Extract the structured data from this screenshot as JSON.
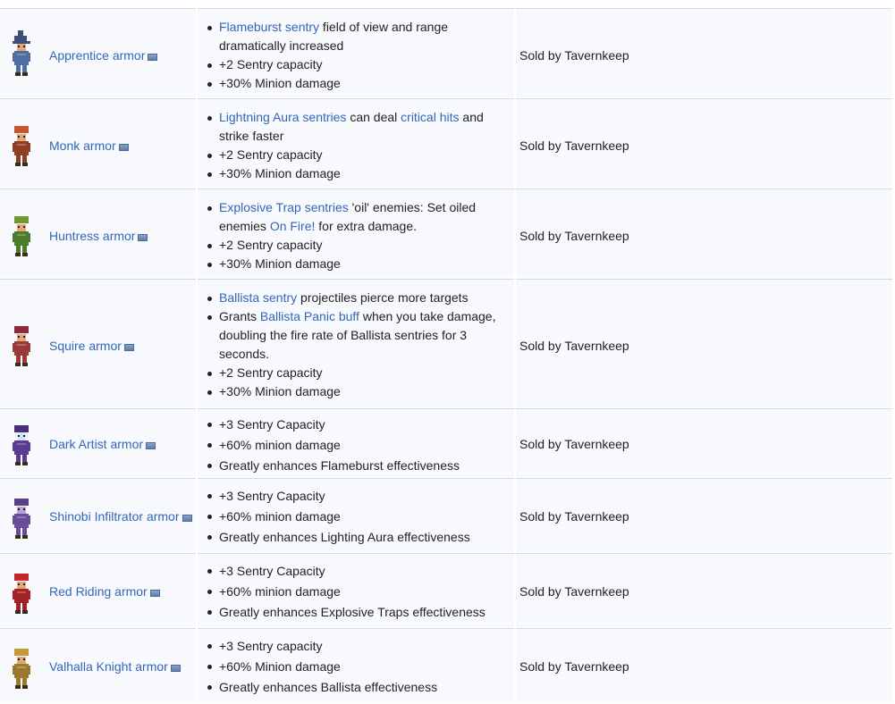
{
  "rows": [
    {
      "name": "Apprentice armor",
      "colors": {
        "hat": "#3d4f7a",
        "robe": "#4c6ea0",
        "skin": "#e3a77a"
      },
      "bullets": [
        {
          "parts": [
            {
              "t": "Flameburst sentry",
              "link": true
            },
            {
              "t": " field of view and range dramatically increased"
            }
          ]
        },
        {
          "parts": [
            {
              "t": "+2 Sentry capacity"
            }
          ]
        },
        {
          "parts": [
            {
              "t": "+30% Minion damage"
            }
          ]
        }
      ],
      "source": "Sold by Tavernkeep"
    },
    {
      "name": "Monk armor",
      "colors": {
        "hat": "#c5562b",
        "robe": "#8e3e24",
        "skin": "#e3a77a"
      },
      "bullets": [
        {
          "parts": [
            {
              "t": "Lightning Aura sentries",
              "link": true
            },
            {
              "t": " can deal "
            },
            {
              "t": "critical hits",
              "link": true
            },
            {
              "t": " and strike faster"
            }
          ]
        },
        {
          "parts": [
            {
              "t": "+2 Sentry capacity"
            }
          ]
        },
        {
          "parts": [
            {
              "t": "+30% Minion damage"
            }
          ]
        }
      ],
      "source": "Sold by Tavernkeep"
    },
    {
      "name": "Huntress armor",
      "colors": {
        "hat": "#6e9a2f",
        "robe": "#4d7a28",
        "skin": "#e3a77a"
      },
      "bullets": [
        {
          "parts": [
            {
              "t": "Explosive Trap sentries",
              "link": true
            },
            {
              "t": " 'oil' enemies: Set oiled enemies "
            },
            {
              "t": "On Fire!",
              "link": true
            },
            {
              "t": " for extra damage."
            }
          ]
        },
        {
          "parts": [
            {
              "t": "+2 Sentry capacity"
            }
          ]
        },
        {
          "parts": [
            {
              "t": "+30% Minion damage"
            }
          ]
        }
      ],
      "source": "Sold by Tavernkeep"
    },
    {
      "name": "Squire armor",
      "colors": {
        "hat": "#8c2b3a",
        "robe": "#9b3a3a",
        "skin": "#e3a77a"
      },
      "bullets": [
        {
          "parts": [
            {
              "t": "Ballista sentry",
              "link": true
            },
            {
              "t": " projectiles pierce more targets"
            }
          ]
        },
        {
          "parts": [
            {
              "t": "Grants "
            },
            {
              "t": "Ballista Panic buff",
              "link": true
            },
            {
              "t": " when you take damage, doubling the fire rate of Ballista sentries for 3 seconds."
            }
          ]
        },
        {
          "parts": [
            {
              "t": "+2 Sentry capacity"
            }
          ]
        },
        {
          "parts": [
            {
              "t": "+30% Minion damage"
            }
          ]
        }
      ],
      "source": "Sold by Tavernkeep"
    },
    {
      "name": "Dark Artist armor",
      "colors": {
        "hat": "#4a2f7a",
        "robe": "#5b3b8f",
        "skin": "#cfe8ff"
      },
      "bullets": [
        {
          "parts": [
            {
              "t": "+3 Sentry Capacity"
            }
          ]
        },
        {
          "parts": [
            {
              "t": "+60% minion damage"
            }
          ]
        },
        {
          "parts": [
            {
              "t": "Greatly enhances Flameburst effectiveness"
            }
          ]
        }
      ],
      "source": "Sold by Tavernkeep"
    },
    {
      "name": "Shinobi Infiltrator armor",
      "colors": {
        "hat": "#5a3f86",
        "robe": "#6b4c9a",
        "skin": "#b7a1d6"
      },
      "bullets": [
        {
          "parts": [
            {
              "t": "+3 Sentry Capacity"
            }
          ]
        },
        {
          "parts": [
            {
              "t": "+60% minion damage"
            }
          ]
        },
        {
          "parts": [
            {
              "t": "Greatly enhances Lighting Aura effectiveness"
            }
          ]
        }
      ],
      "source": "Sold by Tavernkeep"
    },
    {
      "name": "Red Riding armor",
      "colors": {
        "hat": "#c4262c",
        "robe": "#a12328",
        "skin": "#e3a77a"
      },
      "bullets": [
        {
          "parts": [
            {
              "t": "+3 Sentry Capacity"
            }
          ]
        },
        {
          "parts": [
            {
              "t": "+60% minion damage"
            }
          ]
        },
        {
          "parts": [
            {
              "t": "Greatly enhances Explosive Traps effectiveness"
            }
          ]
        }
      ],
      "source": "Sold by Tavernkeep"
    },
    {
      "name": "Valhalla Knight armor",
      "colors": {
        "hat": "#c49a3a",
        "robe": "#9a7a2c",
        "skin": "#e3a77a"
      },
      "bullets": [
        {
          "parts": [
            {
              "t": "+3 Sentry capacity"
            }
          ]
        },
        {
          "parts": [
            {
              "t": "+60% Minion damage"
            }
          ]
        },
        {
          "parts": [
            {
              "t": "Greatly enhances Ballista effectiveness"
            }
          ]
        }
      ],
      "source": "Sold by Tavernkeep"
    }
  ]
}
